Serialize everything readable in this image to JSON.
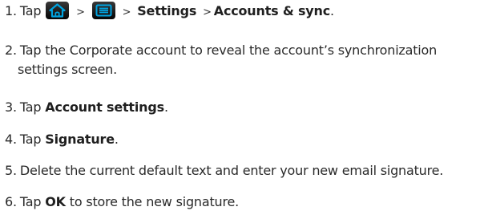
{
  "steps": [
    {
      "number": "1.",
      "prefix": "Tap",
      "home_icon": "home-icon",
      "sep1": ">",
      "menu_icon": "menu-icon",
      "sep2": ">",
      "settings": "Settings",
      "sep3": ">",
      "accounts": "Accounts & sync",
      "end": "."
    },
    {
      "number": "2.",
      "line1": "Tap the Corporate account to reveal the account’s synchronization",
      "line2": "settings screen."
    },
    {
      "number": "3.",
      "prefix": "Tap",
      "bold": "Account settings",
      "end": "."
    },
    {
      "number": "4.",
      "prefix": "Tap",
      "bold": "Signature",
      "end": "."
    },
    {
      "number": "5.",
      "text": "Delete the current default text and enter your new email signature."
    },
    {
      "number": "6.",
      "prefix": "Tap",
      "bold": "OK",
      "suffix": "to store the new signature."
    }
  ],
  "colors": {
    "text": "#2a2a2a",
    "icon_background": "#111111",
    "icon_glyph": "#00a3e0"
  }
}
